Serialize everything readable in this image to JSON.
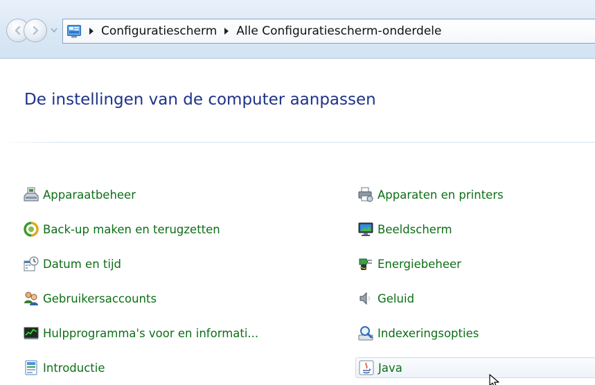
{
  "breadcrumb": {
    "items": [
      "Configuratiescherm",
      "Alle Configuratiescherm-onderdele"
    ]
  },
  "header": {
    "title": "De instellingen van de computer aanpassen"
  },
  "items": {
    "left": [
      {
        "label": "Apparaatbeheer",
        "icon": "device-manager-icon"
      },
      {
        "label": "Back-up maken en terugzetten",
        "icon": "backup-restore-icon"
      },
      {
        "label": "Datum en tijd",
        "icon": "date-time-icon"
      },
      {
        "label": "Gebruikersaccounts",
        "icon": "user-accounts-icon"
      },
      {
        "label": "Hulpprogramma's voor en informati...",
        "icon": "performance-tools-icon"
      },
      {
        "label": "Introductie",
        "icon": "getting-started-icon"
      }
    ],
    "right": [
      {
        "label": "Apparaten en printers",
        "icon": "devices-printers-icon"
      },
      {
        "label": "Beeldscherm",
        "icon": "display-icon"
      },
      {
        "label": "Energiebeheer",
        "icon": "power-options-icon"
      },
      {
        "label": "Geluid",
        "icon": "sound-icon"
      },
      {
        "label": "Indexeringsopties",
        "icon": "indexing-options-icon"
      },
      {
        "label": "Java",
        "icon": "java-icon",
        "selected": true
      }
    ]
  },
  "colors": {
    "title": "#1e3287",
    "link": "#0d6e16",
    "navbar": "#dbe8f5"
  }
}
